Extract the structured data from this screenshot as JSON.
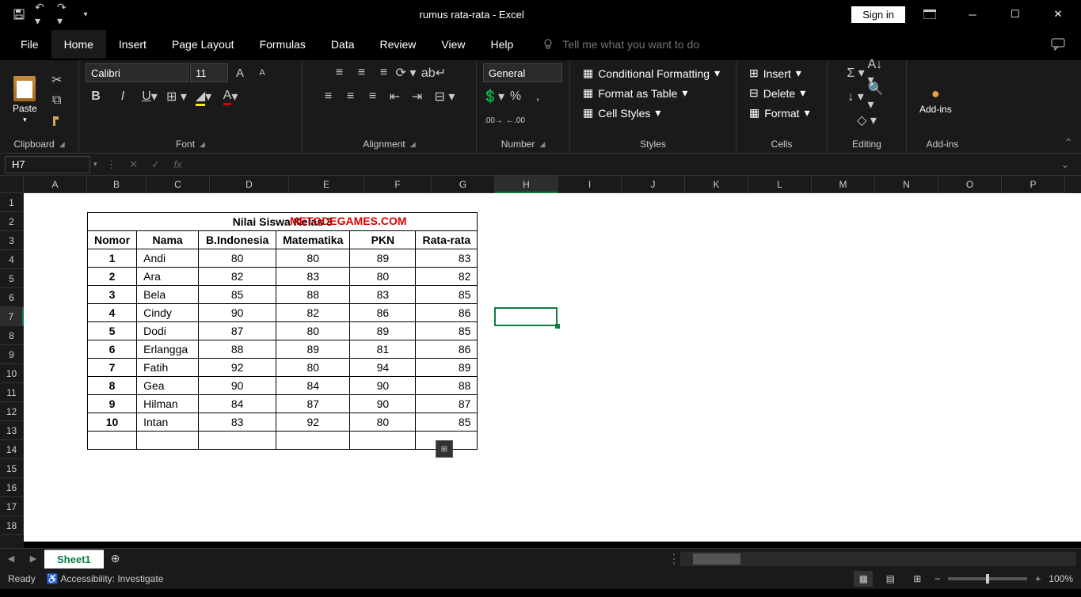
{
  "title": "rumus rata-rata  -  Excel",
  "signin": "Sign in",
  "menus": [
    "File",
    "Home",
    "Insert",
    "Page Layout",
    "Formulas",
    "Data",
    "Review",
    "View",
    "Help"
  ],
  "tell_me_placeholder": "Tell me what you want to do",
  "ribbon": {
    "clipboard": {
      "paste": "Paste",
      "label": "Clipboard"
    },
    "font": {
      "name": "Calibri",
      "size": "11",
      "label": "Font"
    },
    "alignment": {
      "label": "Alignment"
    },
    "number": {
      "format": "General",
      "label": "Number"
    },
    "styles": {
      "cond": "Conditional Formatting",
      "table": "Format as Table",
      "cell": "Cell Styles",
      "label": "Styles"
    },
    "cells": {
      "insert": "Insert",
      "delete": "Delete",
      "format": "Format",
      "label": "Cells"
    },
    "editing": {
      "label": "Editing"
    },
    "addins": {
      "btn": "Add-ins",
      "label": "Add-ins"
    }
  },
  "name_box": "H7",
  "formula": "",
  "columns": [
    "A",
    "B",
    "C",
    "D",
    "E",
    "F",
    "G",
    "H",
    "I",
    "J",
    "K",
    "L",
    "M",
    "N",
    "O",
    "P"
  ],
  "selected_col": "H",
  "selected_row": 7,
  "watermark": "METODEGAMES.COM",
  "table": {
    "title": "Nilai Siswa Kelas 3",
    "headers": [
      "Nomor",
      "Nama",
      "B.Indonesia",
      "Matematika",
      "PKN",
      "Rata-rata"
    ],
    "rows": [
      {
        "no": "1",
        "nama": "Andi",
        "bi": "80",
        "mat": "80",
        "pkn": "89",
        "avg": "83"
      },
      {
        "no": "2",
        "nama": "Ara",
        "bi": "82",
        "mat": "83",
        "pkn": "80",
        "avg": "82"
      },
      {
        "no": "3",
        "nama": "Bela",
        "bi": "85",
        "mat": "88",
        "pkn": "83",
        "avg": "85"
      },
      {
        "no": "4",
        "nama": "Cindy",
        "bi": "90",
        "mat": "82",
        "pkn": "86",
        "avg": "86"
      },
      {
        "no": "5",
        "nama": "Dodi",
        "bi": "87",
        "mat": "80",
        "pkn": "89",
        "avg": "85"
      },
      {
        "no": "6",
        "nama": "Erlangga",
        "bi": "88",
        "mat": "89",
        "pkn": "81",
        "avg": "86"
      },
      {
        "no": "7",
        "nama": "Fatih",
        "bi": "92",
        "mat": "80",
        "pkn": "94",
        "avg": "89"
      },
      {
        "no": "8",
        "nama": "Gea",
        "bi": "90",
        "mat": "84",
        "pkn": "90",
        "avg": "88"
      },
      {
        "no": "9",
        "nama": "Hilman",
        "bi": "84",
        "mat": "87",
        "pkn": "90",
        "avg": "87"
      },
      {
        "no": "10",
        "nama": "Intan",
        "bi": "83",
        "mat": "92",
        "pkn": "80",
        "avg": "85"
      }
    ]
  },
  "sheet_tab": "Sheet1",
  "status": {
    "ready": "Ready",
    "a11y": "Accessibility: Investigate",
    "zoom": "100%"
  }
}
